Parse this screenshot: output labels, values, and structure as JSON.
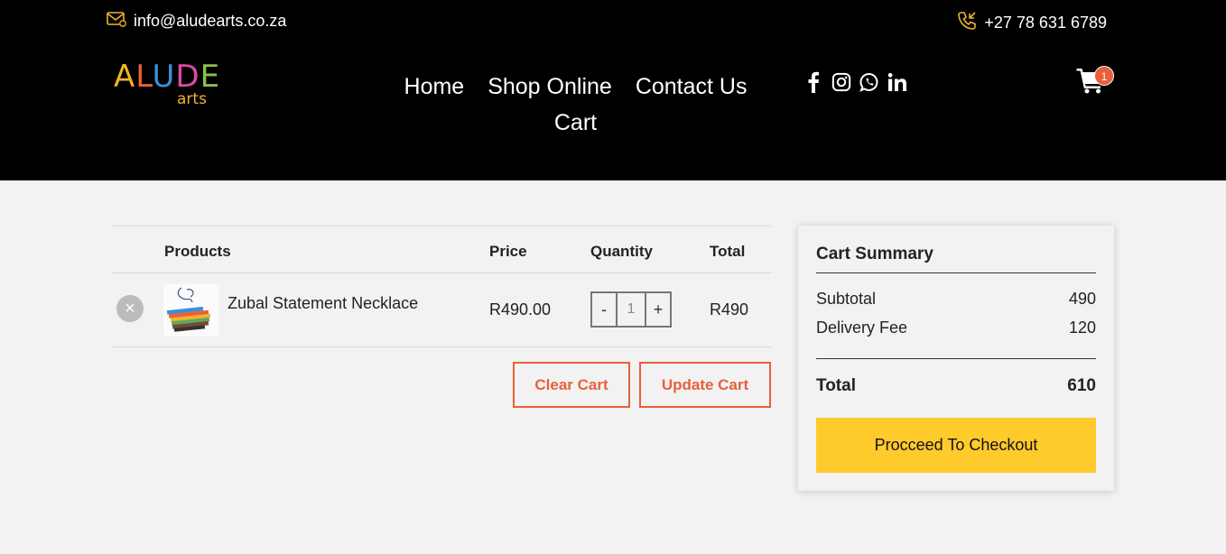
{
  "topbar": {
    "email": "info@aludearts.co.za",
    "phone": "+27 78 631 6789"
  },
  "logo": {
    "letters": [
      "A",
      "L",
      "U",
      "D",
      "E"
    ],
    "sub": "arts"
  },
  "nav": {
    "items": [
      "Home",
      "Shop Online",
      "Contact Us",
      "Cart"
    ]
  },
  "social": {
    "icons": [
      "facebook-icon",
      "instagram-icon",
      "whatsapp-icon",
      "linkedin-icon"
    ]
  },
  "cart": {
    "badge_count": "1"
  },
  "table": {
    "headers": {
      "products": "Products",
      "price": "Price",
      "quantity": "Quantity",
      "total": "Total"
    },
    "rows": [
      {
        "name": "Zubal Statement Necklace",
        "price": "R490.00",
        "qty": "1",
        "total": "R490"
      }
    ],
    "qty_minus": "-",
    "qty_plus": "+",
    "remove_symbol": "×"
  },
  "actions": {
    "clear": "Clear Cart",
    "update": "Update Cart"
  },
  "summary": {
    "title": "Cart Summary",
    "subtotal_label": "Subtotal",
    "subtotal": "490",
    "delivery_label": "Delivery Fee",
    "delivery": "120",
    "total_label": "Total",
    "total": "610",
    "checkout": "Procceed To Checkout"
  },
  "colors": {
    "header_bg": "#000000",
    "accent_orange": "#e8603c",
    "checkout_yellow": "#ffca2c",
    "page_bg": "#f2f2f2"
  }
}
